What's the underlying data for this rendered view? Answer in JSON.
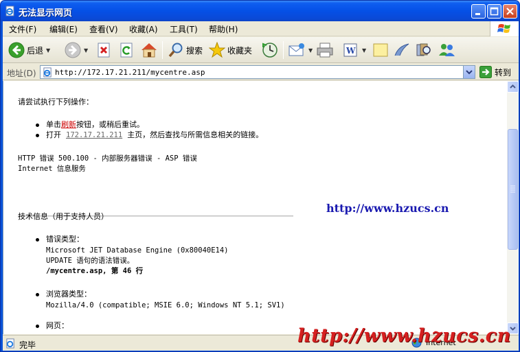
{
  "window": {
    "title": "无法显示网页",
    "colors": {
      "titlebar": "#0550e6",
      "close": "#c9401d",
      "chrome": "#ece9d8"
    }
  },
  "menu": {
    "items": [
      "文件(F)",
      "编辑(E)",
      "查看(V)",
      "收藏(A)",
      "工具(T)",
      "帮助(H)"
    ]
  },
  "toolbar": {
    "back_label": "后退",
    "search_label": "搜索",
    "favorites_label": "收藏夹"
  },
  "address": {
    "label": "地址(D)",
    "url": "http://172.17.21.211/mycentre.asp",
    "go_label": "转到"
  },
  "content": {
    "intro": "请尝试执行下列操作：",
    "bullet1_prefix": "单击",
    "bullet1_link": "刷新",
    "bullet1_suffix": "按钮，或稍后重试。",
    "bullet2_prefix": "打开",
    "bullet2_link": "172.17.21.211",
    "bullet2_suffix": "主页，然后查找与所需信息相关的链接。",
    "error_line1": "HTTP 错误 500.100 - 内部服务器错误 - ASP 错误",
    "error_line2": "Internet 信息服务",
    "tech_heading": "技术信息（用于支持人员）",
    "err_type_label": "错误类型：",
    "err_type_line1": "Microsoft JET Database Engine (0x80040E14)",
    "err_type_line2": "UPDATE 语句的语法错误。",
    "err_type_line3": "/mycentre.asp, 第 46 行",
    "browser_label": "浏览器类型：",
    "browser_value": "Mozilla/4.0 (compatible; MSIE 6.0; Windows NT 5.1; SV1)",
    "page_label": "网页："
  },
  "watermarks": {
    "blue": "http://www.hzucs.cn",
    "red": "http://www.hzucs.cn"
  },
  "status": {
    "text": "完毕",
    "zone": "Internet"
  },
  "icons": [
    "ie-page-icon",
    "minimize-icon",
    "maximize-icon",
    "close-icon",
    "windows-logo-icon",
    "back-icon",
    "forward-icon",
    "stop-icon",
    "refresh-icon",
    "home-icon",
    "search-icon",
    "favorites-icon",
    "history-icon",
    "mail-icon",
    "print-icon",
    "edit-icon",
    "discuss-icon",
    "messenger-icon",
    "research-icon",
    "contacts-icon",
    "go-icon",
    "globe-icon"
  ]
}
